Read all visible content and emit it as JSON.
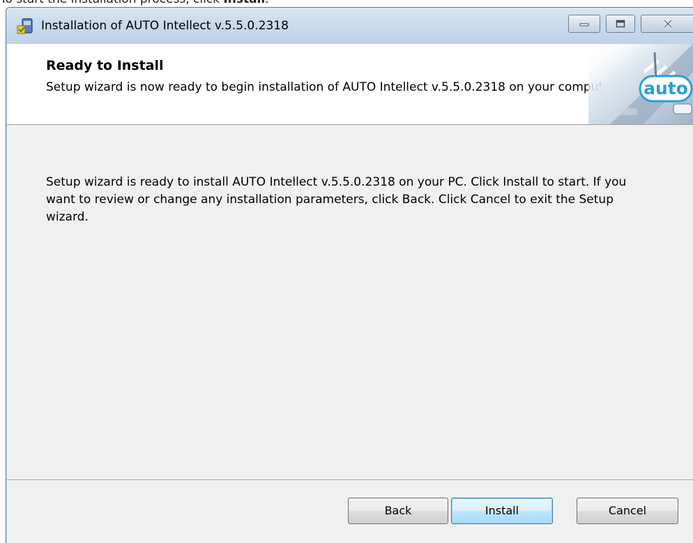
{
  "instruction": {
    "prefix": "To start the installation process, click ",
    "bold": "Install",
    "suffix": "."
  },
  "window": {
    "title": "Installation of AUTO Intellect v.5.5.0.2318",
    "icon": "installer-icon",
    "controls": [
      "minimize-icon",
      "maximize-icon",
      "close-icon"
    ]
  },
  "banner": {
    "heading": "Ready to Install",
    "description": "Setup wizard is now ready to begin installation of AUTO Intellect v.5.5.0.2318 on your computer.",
    "logo_text": "auto"
  },
  "content": {
    "message": "Setup wizard is ready to install AUTO Intellect v.5.5.0.2318 on your PC. Click Install to start. If you want to review or change any installation parameters, click Back. Click Cancel to exit the Setup wizard."
  },
  "buttons": {
    "back": "Back",
    "install": "Install",
    "cancel": "Cancel"
  },
  "colors": {
    "titlebar": "#c4d5e9",
    "dialog_background": "#f0f0f0",
    "default_button_border": "#3c7fb1",
    "logo_accent": "#2a9fd6"
  }
}
